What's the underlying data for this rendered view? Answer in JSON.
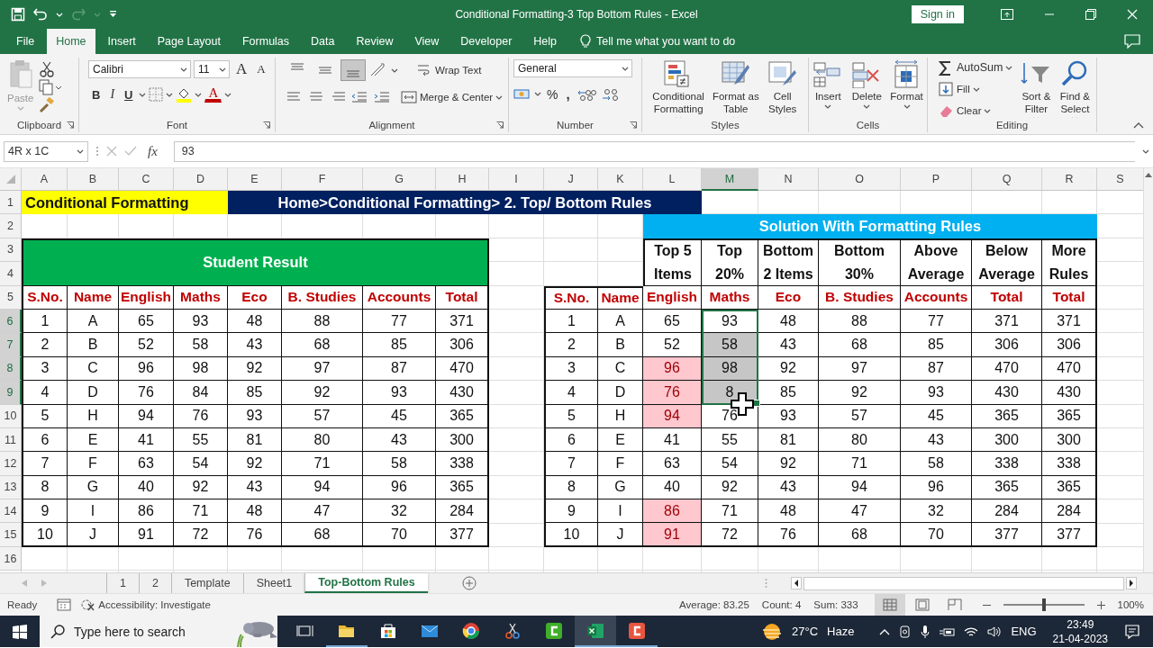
{
  "title_bar": {
    "title": "Conditional Formatting-3 Top Bottom Rules - Excel",
    "sign_in": "Sign in"
  },
  "menu_tabs": [
    {
      "label": "File",
      "selected": false
    },
    {
      "label": "Home",
      "selected": true
    },
    {
      "label": "Insert",
      "selected": false
    },
    {
      "label": "Page Layout",
      "selected": false
    },
    {
      "label": "Formulas",
      "selected": false
    },
    {
      "label": "Data",
      "selected": false
    },
    {
      "label": "Review",
      "selected": false
    },
    {
      "label": "View",
      "selected": false
    },
    {
      "label": "Developer",
      "selected": false
    },
    {
      "label": "Help",
      "selected": false
    }
  ],
  "tell_me": "Tell me what you want to do",
  "ribbon": {
    "clipboard": {
      "label": "Clipboard",
      "paste": "Paste"
    },
    "font": {
      "label": "Font",
      "font_name": "Calibri",
      "font_size": "11",
      "grow_font": "A",
      "shrink_font": "A",
      "bold": "B",
      "italic": "I",
      "underline": "U",
      "font_color": "A"
    },
    "alignment": {
      "label": "Alignment",
      "vertical_align": [
        {
          "selected": false
        },
        {
          "selected": false
        },
        {
          "selected": true
        }
      ],
      "wrap_text": "Wrap Text",
      "merge": "Merge & Center"
    },
    "number": {
      "label": "Number",
      "format": "General",
      "percent": "%",
      "comma": ","
    },
    "styles": {
      "label": "Styles",
      "buttons": [
        "Conditional\nFormatting",
        "Format as\nTable",
        "Cell\nStyles"
      ]
    },
    "cells": {
      "label": "Cells",
      "buttons": [
        "Insert",
        "Delete",
        "Format"
      ]
    },
    "editing": {
      "label": "Editing",
      "small_buttons": [
        "AutoSum",
        "Fill",
        "Clear"
      ],
      "big_buttons": [
        "Sort &\nFilter",
        "Find &\nSelect"
      ]
    }
  },
  "formula_bar": {
    "name_box": "4R x 1C",
    "fx": "fx",
    "value": "93"
  },
  "sheet": {
    "columns": [
      {
        "label": "A",
        "selected": false
      },
      {
        "label": "B",
        "selected": false
      },
      {
        "label": "C",
        "selected": false
      },
      {
        "label": "D",
        "selected": false
      },
      {
        "label": "E",
        "selected": false
      },
      {
        "label": "F",
        "selected": false
      },
      {
        "label": "G",
        "selected": false
      },
      {
        "label": "H",
        "selected": false
      },
      {
        "label": "I",
        "selected": false
      },
      {
        "label": "J",
        "selected": false
      },
      {
        "label": "K",
        "selected": false
      },
      {
        "label": "L",
        "selected": false
      },
      {
        "label": "M",
        "selected": true
      },
      {
        "label": "N",
        "selected": false
      },
      {
        "label": "O",
        "selected": false
      },
      {
        "label": "P",
        "selected": false
      },
      {
        "label": "Q",
        "selected": false
      },
      {
        "label": "R",
        "selected": false
      },
      {
        "label": "S",
        "selected": false
      }
    ],
    "row_headers": [
      {
        "label": "1",
        "selected": false
      },
      {
        "label": "2",
        "selected": false
      },
      {
        "label": "3",
        "selected": false
      },
      {
        "label": "4",
        "selected": false
      },
      {
        "label": "5",
        "selected": false
      },
      {
        "label": "6",
        "selected": true
      },
      {
        "label": "7",
        "selected": true
      },
      {
        "label": "8",
        "selected": true
      },
      {
        "label": "9",
        "selected": true
      },
      {
        "label": "10",
        "selected": false
      },
      {
        "label": "11",
        "selected": false
      },
      {
        "label": "12",
        "selected": false
      },
      {
        "label": "13",
        "selected": false
      },
      {
        "label": "14",
        "selected": false
      },
      {
        "label": "15",
        "selected": false
      },
      {
        "label": "16",
        "selected": false
      }
    ],
    "banner": {
      "left": "Conditional Formatting",
      "right": "Home>Conditional Formatting> 2. Top/ Bottom Rules"
    },
    "left_table": {
      "title": "Student Result",
      "headers": [
        "S.No.",
        "Name",
        "English",
        "Maths",
        "Eco",
        "B. Studies",
        "Accounts",
        "Total"
      ],
      "rows": [
        [
          "1",
          "A",
          "65",
          "93",
          "48",
          "88",
          "77",
          "371"
        ],
        [
          "2",
          "B",
          "52",
          "58",
          "43",
          "68",
          "85",
          "306"
        ],
        [
          "3",
          "C",
          "96",
          "98",
          "92",
          "97",
          "87",
          "470"
        ],
        [
          "4",
          "D",
          "76",
          "84",
          "85",
          "92",
          "93",
          "430"
        ],
        [
          "5",
          "H",
          "94",
          "76",
          "93",
          "57",
          "45",
          "365"
        ],
        [
          "6",
          "E",
          "41",
          "55",
          "81",
          "80",
          "43",
          "300"
        ],
        [
          "7",
          "F",
          "63",
          "54",
          "92",
          "71",
          "58",
          "338"
        ],
        [
          "8",
          "G",
          "40",
          "92",
          "43",
          "94",
          "96",
          "365"
        ],
        [
          "9",
          "I",
          "86",
          "71",
          "48",
          "47",
          "32",
          "284"
        ],
        [
          "10",
          "J",
          "91",
          "72",
          "76",
          "68",
          "70",
          "377"
        ]
      ]
    },
    "right_table": {
      "title": "Solution With Formatting Rules",
      "rule_headers": [
        "Top 5\nItems",
        "Top\n20%",
        "Bottom\n2 Items",
        "Bottom\n30%",
        "Above\nAverage",
        "Below\nAverage",
        "More\nRules"
      ],
      "headers": [
        "S.No.",
        "Name",
        "English",
        "Maths",
        "Eco",
        "B. Studies",
        "Accounts",
        "Total",
        "Total"
      ],
      "rows": [
        {
          "values": [
            "1",
            "A",
            "65",
            "93",
            "48",
            "88",
            "77",
            "371",
            "371"
          ],
          "highlighted": [
            false,
            false,
            false,
            false,
            false,
            false,
            false,
            false,
            false
          ],
          "selected": [
            false,
            false,
            false,
            true,
            false,
            false,
            false,
            false,
            false
          ]
        },
        {
          "values": [
            "2",
            "B",
            "52",
            "58",
            "43",
            "68",
            "85",
            "306",
            "306"
          ],
          "highlighted": [
            false,
            false,
            false,
            false,
            false,
            false,
            false,
            false,
            false
          ],
          "selected": [
            false,
            false,
            false,
            true,
            false,
            false,
            false,
            false,
            false
          ]
        },
        {
          "values": [
            "3",
            "C",
            "96",
            "98",
            "92",
            "97",
            "87",
            "470",
            "470"
          ],
          "highlighted": [
            false,
            false,
            true,
            false,
            false,
            false,
            false,
            false,
            false
          ],
          "selected": [
            false,
            false,
            false,
            true,
            false,
            false,
            false,
            false,
            false
          ]
        },
        {
          "values": [
            "4",
            "D",
            "76",
            "8",
            "85",
            "92",
            "93",
            "430",
            "430"
          ],
          "highlighted": [
            false,
            false,
            true,
            false,
            false,
            false,
            false,
            false,
            false
          ],
          "selected": [
            false,
            false,
            false,
            true,
            false,
            false,
            false,
            false,
            false
          ]
        },
        {
          "values": [
            "5",
            "H",
            "94",
            "76",
            "93",
            "57",
            "45",
            "365",
            "365"
          ],
          "highlighted": [
            false,
            false,
            true,
            false,
            false,
            false,
            false,
            false,
            false
          ],
          "selected": [
            false,
            false,
            false,
            false,
            false,
            false,
            false,
            false,
            false
          ]
        },
        {
          "values": [
            "6",
            "E",
            "41",
            "55",
            "81",
            "80",
            "43",
            "300",
            "300"
          ],
          "highlighted": [
            false,
            false,
            false,
            false,
            false,
            false,
            false,
            false,
            false
          ],
          "selected": [
            false,
            false,
            false,
            false,
            false,
            false,
            false,
            false,
            false
          ]
        },
        {
          "values": [
            "7",
            "F",
            "63",
            "54",
            "92",
            "71",
            "58",
            "338",
            "338"
          ],
          "highlighted": [
            false,
            false,
            false,
            false,
            false,
            false,
            false,
            false,
            false
          ],
          "selected": [
            false,
            false,
            false,
            false,
            false,
            false,
            false,
            false,
            false
          ]
        },
        {
          "values": [
            "8",
            "G",
            "40",
            "92",
            "43",
            "94",
            "96",
            "365",
            "365"
          ],
          "highlighted": [
            false,
            false,
            false,
            false,
            false,
            false,
            false,
            false,
            false
          ],
          "selected": [
            false,
            false,
            false,
            false,
            false,
            false,
            false,
            false,
            false
          ]
        },
        {
          "values": [
            "9",
            "I",
            "86",
            "71",
            "48",
            "47",
            "32",
            "284",
            "284"
          ],
          "highlighted": [
            false,
            false,
            true,
            false,
            false,
            false,
            false,
            false,
            false
          ],
          "selected": [
            false,
            false,
            false,
            false,
            false,
            false,
            false,
            false,
            false
          ]
        },
        {
          "values": [
            "10",
            "J",
            "91",
            "72",
            "76",
            "68",
            "70",
            "377",
            "377"
          ],
          "highlighted": [
            false,
            false,
            true,
            false,
            false,
            false,
            false,
            false,
            false
          ],
          "selected": [
            false,
            false,
            false,
            false,
            false,
            false,
            false,
            false,
            false
          ]
        }
      ]
    }
  },
  "sheet_tabs": [
    {
      "label": "1",
      "selected": false
    },
    {
      "label": "2",
      "selected": false
    },
    {
      "label": "Template",
      "selected": false
    },
    {
      "label": "Sheet1",
      "selected": false
    },
    {
      "label": "Top-Bottom Rules",
      "selected": true
    }
  ],
  "status_bar": {
    "mode": "Ready",
    "accessibility": "Accessibility: Investigate",
    "average": "Average: 83.25",
    "count": "Count: 4",
    "sum": "Sum: 333",
    "view_buttons": [
      {
        "selected": true
      },
      {
        "selected": false
      },
      {
        "selected": false
      }
    ],
    "zoom": {
      "level": 0.5,
      "label": "100%"
    }
  },
  "taskbar": {
    "search_placeholder": "Type here to search",
    "apps": [
      {
        "running": true,
        "active": false
      },
      {
        "running": false,
        "active": false
      },
      {
        "running": false,
        "active": false
      },
      {
        "running": false,
        "active": false
      },
      {
        "running": false,
        "active": false
      },
      {
        "running": false,
        "active": false
      },
      {
        "running": true,
        "active": true
      },
      {
        "running": true,
        "active": false
      }
    ],
    "temperature": "27°C",
    "weather": "Haze",
    "language": "ENG",
    "time": "23:49",
    "date": "21-04-2023"
  }
}
